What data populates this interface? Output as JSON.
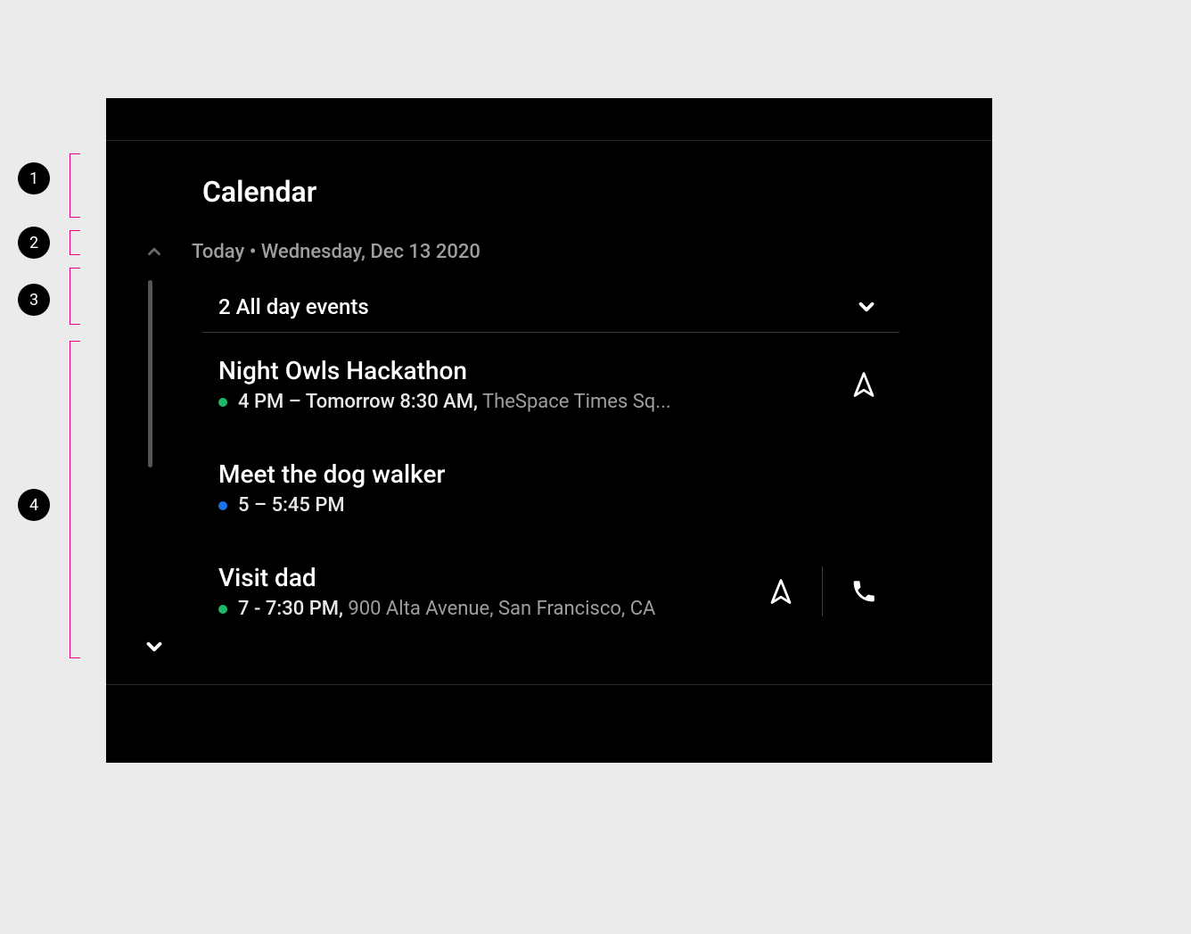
{
  "annotations": {
    "1": "1",
    "2": "2",
    "3": "3",
    "4": "4"
  },
  "app": {
    "title": "Calendar"
  },
  "date": {
    "label": "Today • Wednesday, Dec 13 2020"
  },
  "allday": {
    "label": "2 All day events"
  },
  "events": [
    {
      "title": "Night Owls Hackathon",
      "time": "4 PM – Tomorrow 8:30 AM,",
      "location": "TheSpace Times Sq...",
      "dot_color": "green",
      "has_nav": true,
      "has_call": false
    },
    {
      "title": "Meet the dog walker",
      "time": "5 – 5:45 PM",
      "location": "",
      "dot_color": "blue",
      "has_nav": false,
      "has_call": false
    },
    {
      "title": "Visit dad",
      "time": "7 - 7:30 PM,",
      "location": "900 Alta Avenue, San Francisco, CA",
      "dot_color": "green",
      "has_nav": true,
      "has_call": true
    }
  ]
}
